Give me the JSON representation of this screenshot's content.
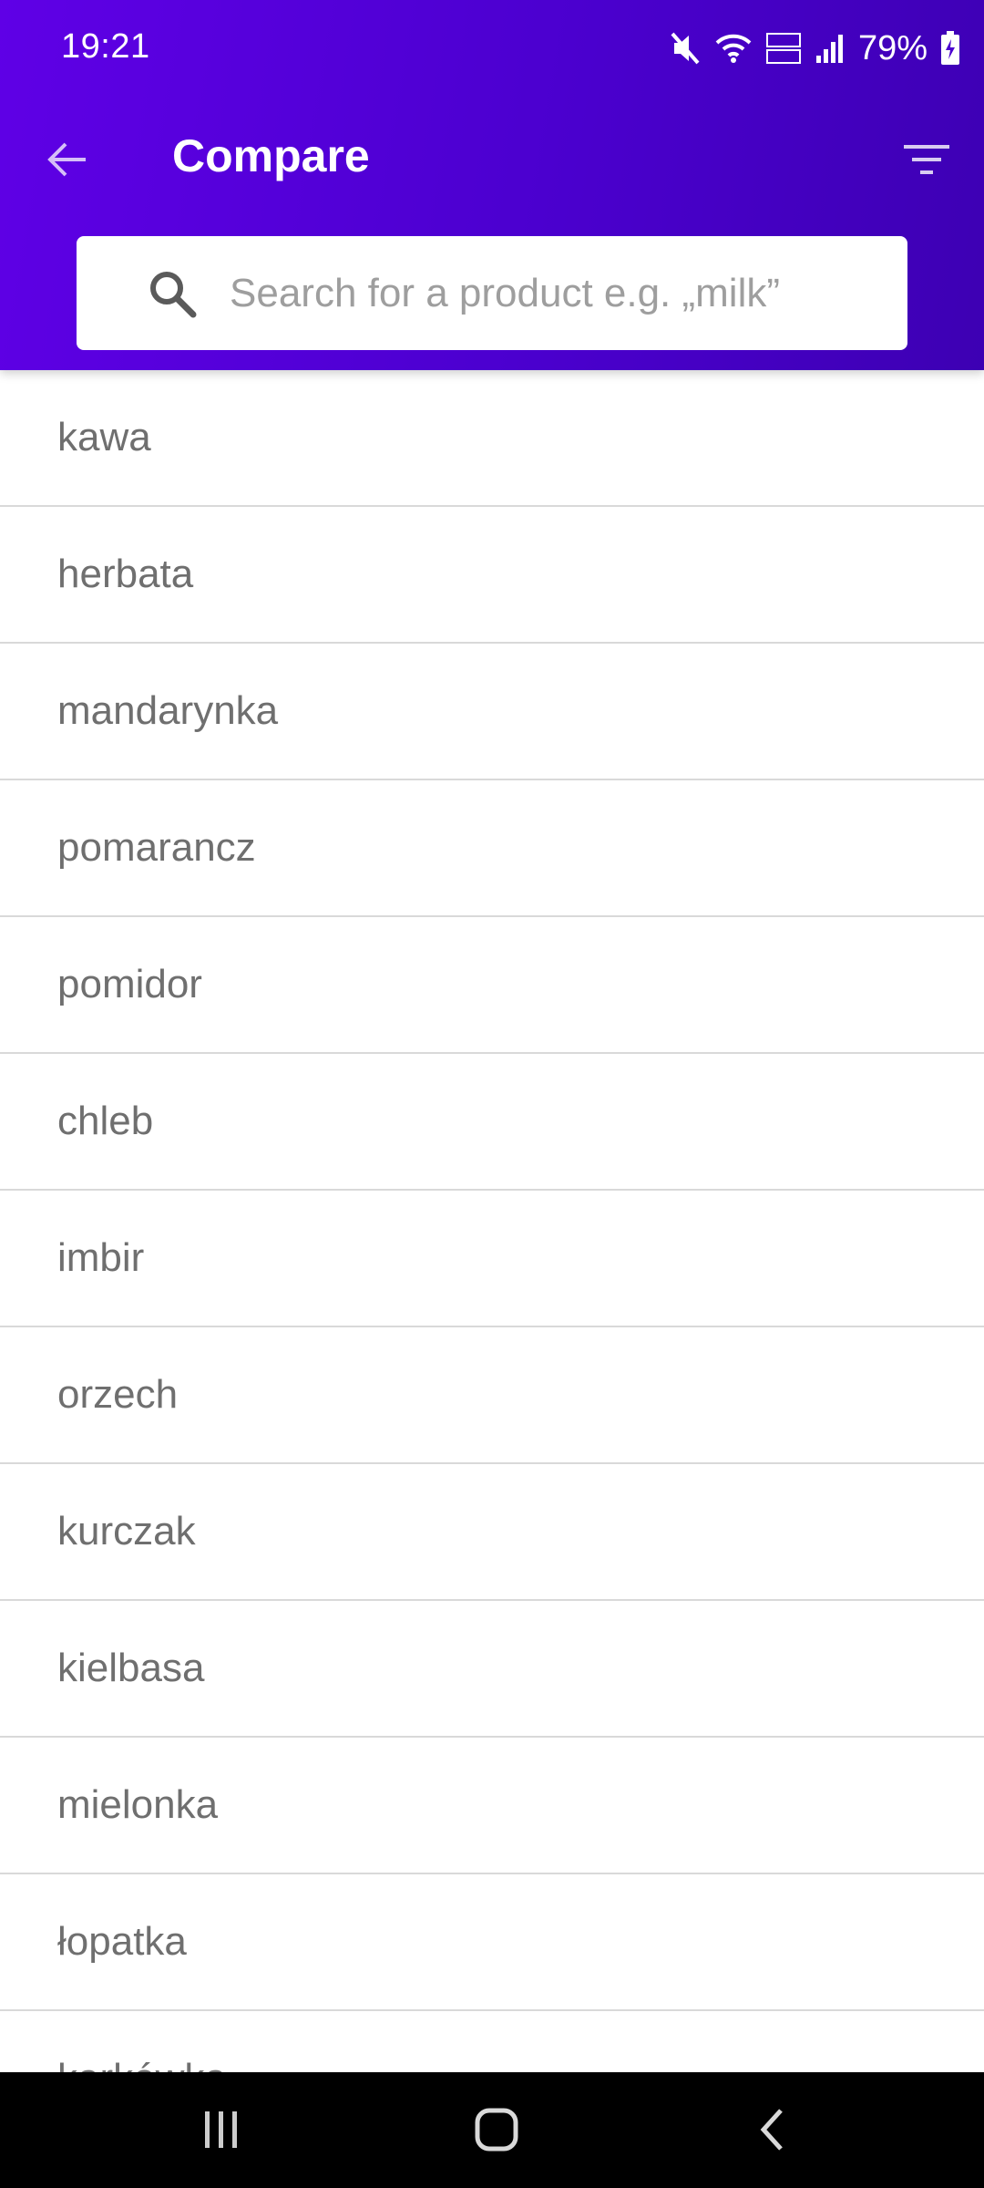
{
  "status_bar": {
    "time": "19:21",
    "battery": "79%",
    "icons": [
      "mute-icon",
      "wifi-icon",
      "volte-icon",
      "signal-icon",
      "battery-charging-icon"
    ]
  },
  "app_bar": {
    "title": "Compare",
    "back_icon": "arrow-back-icon",
    "filter_icon": "filter-icon"
  },
  "search": {
    "placeholder": "Search for a product e.g. „milk”",
    "value": ""
  },
  "products": [
    "kawa",
    "herbata",
    "mandarynka",
    "pomarancz",
    "pomidor",
    "chleb",
    "imbir",
    "orzech",
    "kurczak",
    "kielbasa",
    "mielonka",
    "łopatka",
    "karkówka"
  ],
  "nav_bar": {
    "icons": [
      "recent-apps-icon",
      "home-icon",
      "back-icon"
    ]
  },
  "colors": {
    "header_start": "#5f00e6",
    "header_end": "#3d00b3",
    "list_text": "#6f6f6f",
    "divider": "#d9d9d9"
  }
}
